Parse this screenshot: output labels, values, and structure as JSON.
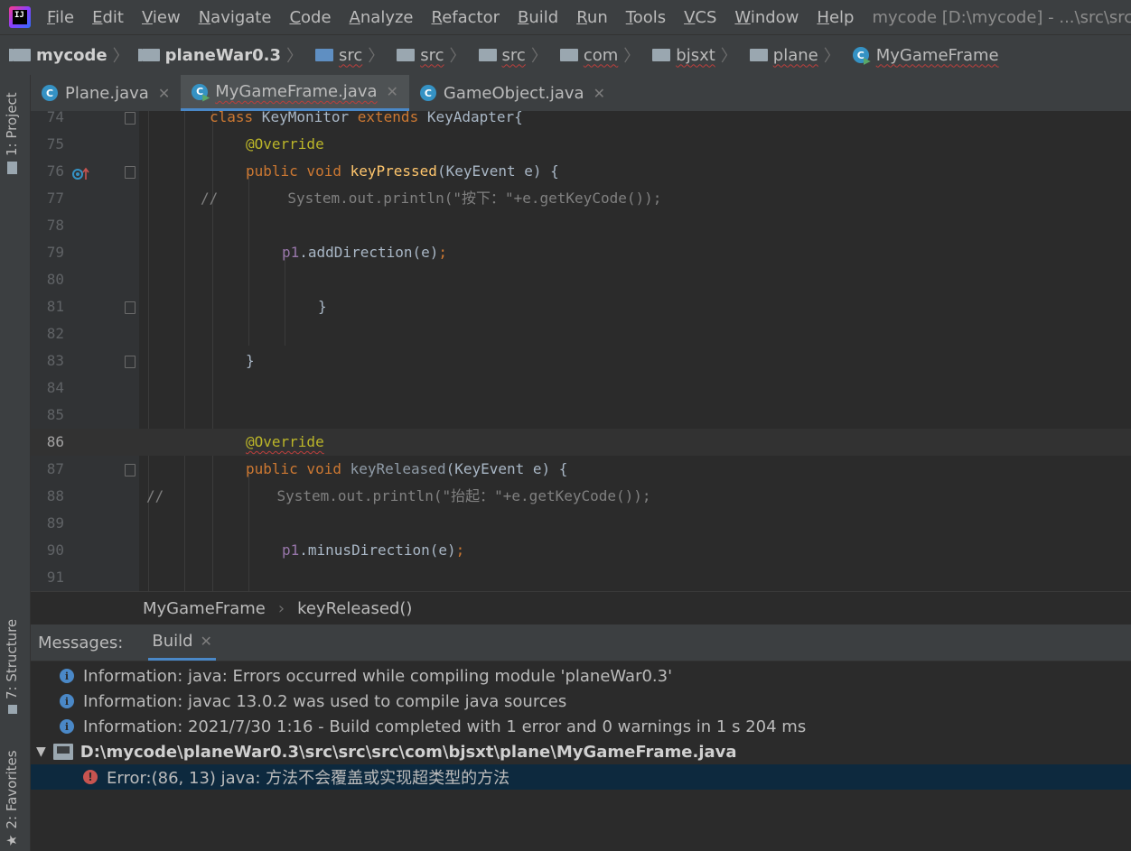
{
  "menubar": {
    "items": [
      "File",
      "Edit",
      "View",
      "Navigate",
      "Code",
      "Analyze",
      "Refactor",
      "Build",
      "Run",
      "Tools",
      "VCS",
      "Window",
      "Help"
    ],
    "window_title": "mycode [D:\\mycode] - ...\\src\\src\\src\\"
  },
  "navbar": {
    "crumbs": [
      "mycode",
      "planeWar0.3",
      "src",
      "src",
      "src",
      "com",
      "bjsxt",
      "plane",
      "MyGameFrame"
    ]
  },
  "left_stripe": {
    "project": "1: Project",
    "structure": "7: Structure",
    "favorites": "2: Favorites"
  },
  "tabs": [
    {
      "label": "Plane.java"
    },
    {
      "label": "MyGameFrame.java"
    },
    {
      "label": "GameObject.java"
    }
  ],
  "editor": {
    "line_numbers": [
      "74",
      "75",
      "76",
      "77",
      "78",
      "79",
      "80",
      "81",
      "82",
      "83",
      "84",
      "85",
      "86",
      "87",
      "88",
      "89",
      "90",
      "91"
    ],
    "current_line": "86"
  },
  "code_crumbs": {
    "class": "MyGameFrame",
    "method": "keyReleased()"
  },
  "messages": {
    "title": "Messages:",
    "tab": "Build",
    "info": [
      "Information: java: Errors occurred while compiling module 'planeWar0.3'",
      "Information: javac 13.0.2 was used to compile java sources",
      "Information: 2021/7/30 1:16 - Build completed with 1 error and 0 warnings in 1 s 204 ms"
    ],
    "file": "D:\\mycode\\planeWar0.3\\src\\src\\src\\com\\bjsxt\\plane\\MyGameFrame.java",
    "error": "Error:(86, 13)  java: 方法不会覆盖或实现超类型的方法"
  },
  "colors": {
    "accent": "#4a88c7",
    "error": "#c75450",
    "keyword": "#cc7832",
    "annotation": "#bbb529"
  }
}
